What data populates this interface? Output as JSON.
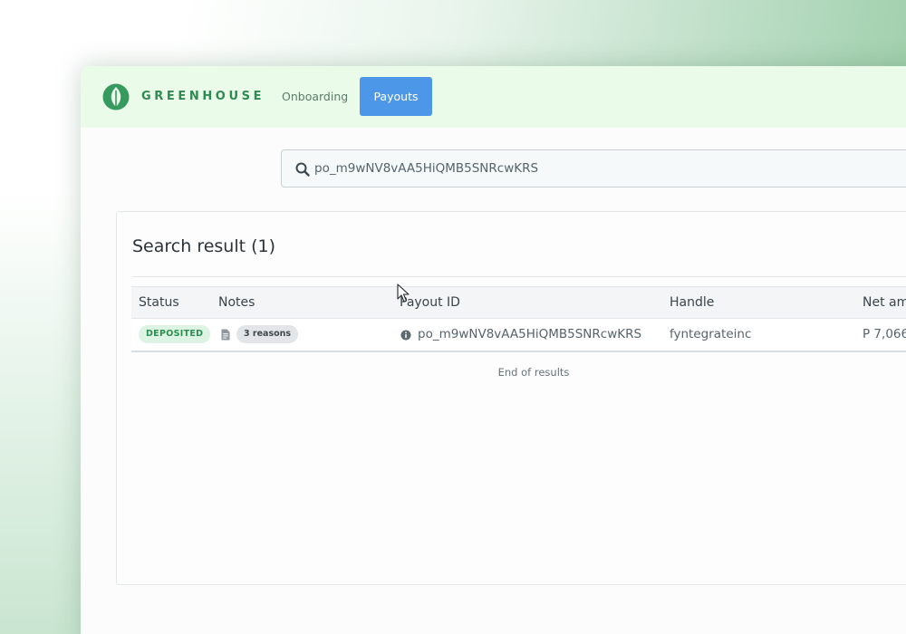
{
  "header": {
    "brand": "GREENHOUSE",
    "nav": [
      {
        "label": "Onboarding",
        "active": false
      },
      {
        "label": "Payouts",
        "active": true
      }
    ]
  },
  "search": {
    "value": "po_m9wNV8vAA5HiQMB5SNRcwKRS",
    "icon": "search-icon"
  },
  "results": {
    "title": "Search result (1)",
    "columns": [
      "Status",
      "Notes",
      "Payout ID",
      "Handle",
      "Net am"
    ],
    "rows": [
      {
        "status": "DEPOSITED",
        "notes": "3 reasons",
        "payout_id": "po_m9wNV8vAA5HiQMB5SNRcwKRS",
        "handle": "fyntegrateinc",
        "net_amount": "P 7,066"
      }
    ],
    "footer": "End of results"
  },
  "colors": {
    "brand_green": "#2f8a52",
    "active_tab": "#4d97e9",
    "deposited_bg": "#ddf4e4",
    "deposited_text": "#2d8e51"
  }
}
